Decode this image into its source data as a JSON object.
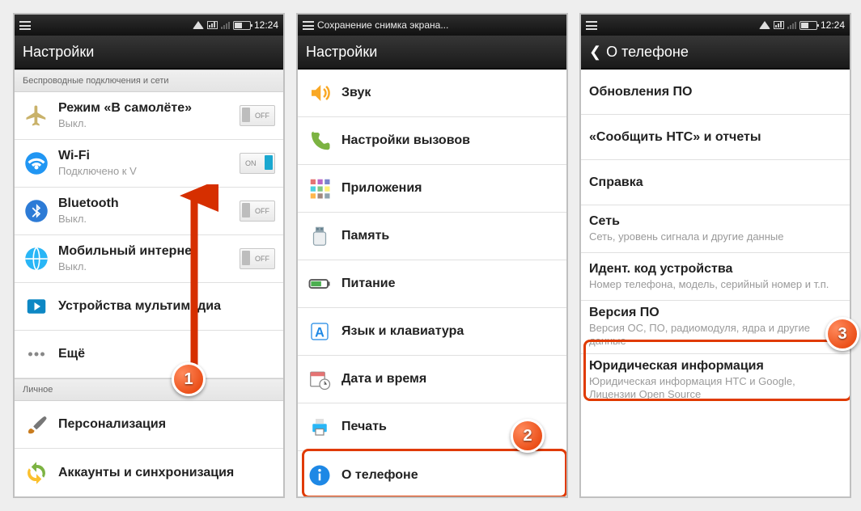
{
  "status": {
    "time": "12:24",
    "saving": "Сохранение снимка экрана..."
  },
  "toggle": {
    "on": "ON",
    "off": "OFF"
  },
  "badges": {
    "b1": "1",
    "b2": "2",
    "b3": "3"
  },
  "panel1": {
    "title": "Настройки",
    "section_wireless": "Беспроводные подключения и сети",
    "airplane": {
      "label": "Режим «В самолёте»",
      "sub": "Выкл."
    },
    "wifi": {
      "label": "Wi-Fi",
      "sub": "Подключено к V"
    },
    "bluetooth": {
      "label": "Bluetooth",
      "sub": "Выкл."
    },
    "mobile": {
      "label": "Мобильный интернет",
      "sub": "Выкл."
    },
    "multimedia": {
      "label": "Устройства мультимедиа"
    },
    "more": {
      "label": "Ещё"
    },
    "section_personal": "Личное",
    "personalize": {
      "label": "Персонализация"
    },
    "accounts": {
      "label": "Аккаунты и синхронизация"
    }
  },
  "panel2": {
    "title": "Настройки",
    "sound": {
      "label": "Звук"
    },
    "calls": {
      "label": "Настройки вызовов"
    },
    "apps": {
      "label": "Приложения"
    },
    "storage": {
      "label": "Память"
    },
    "power": {
      "label": "Питание"
    },
    "lang": {
      "label": "Язык и клавиатура"
    },
    "datetime": {
      "label": "Дата и время"
    },
    "print": {
      "label": "Печать"
    },
    "about": {
      "label": "О телефоне"
    }
  },
  "panel3": {
    "back": "❮",
    "title": "О телефоне",
    "update": {
      "label": "Обновления ПО"
    },
    "tell_htc": {
      "label": "«Сообщить HTC» и отчеты"
    },
    "help": {
      "label": "Справка"
    },
    "network": {
      "label": "Сеть",
      "sub": "Сеть, уровень сигнала и другие данные"
    },
    "ident": {
      "label": "Идент. код устройства",
      "sub": "Номер телефона, модель, серийный номер и т.п."
    },
    "swver": {
      "label": "Версия ПО",
      "sub": "Версия ОС, ПО, радиомодуля, ядра и другие данные"
    },
    "legal": {
      "label": "Юридическая информация",
      "sub": "Юридическая информация HTC и Google, Лицензии Open Source"
    }
  }
}
